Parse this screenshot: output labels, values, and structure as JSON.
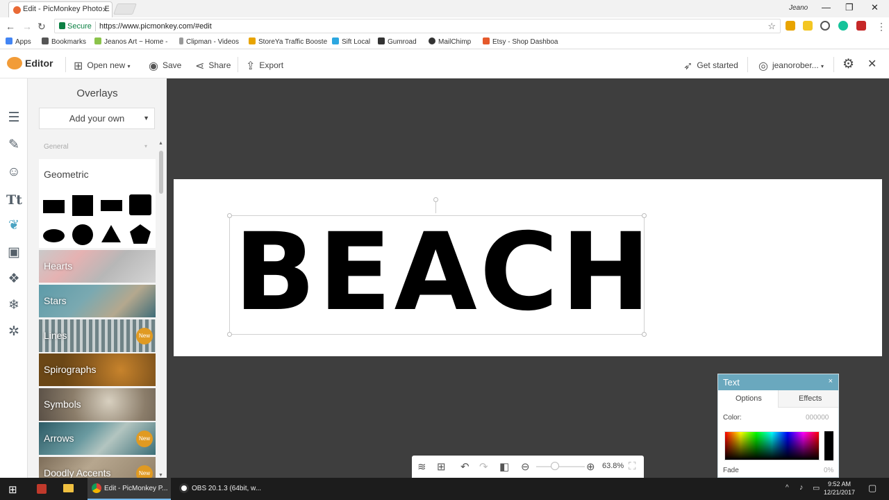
{
  "browser": {
    "tab_title": "Edit - PicMonkey Photo E",
    "tab_close": "×",
    "profile_name": "Jeano",
    "minimize": "—",
    "maximize": "❐",
    "close": "✕",
    "secure_label": "Secure",
    "url": "https://www.picmonkey.com/#edit"
  },
  "bookmarks": [
    {
      "label": "Apps",
      "color": "#4285f4"
    },
    {
      "label": "Bookmarks",
      "color": "#555555"
    },
    {
      "label": "Jeanos Art ~ Home -",
      "color": "#8bc34a"
    },
    {
      "label": "Clipman - Videos",
      "color": "#999999"
    },
    {
      "label": "StoreYa Traffic Booste",
      "color": "#e8a400"
    },
    {
      "label": "Sift Local",
      "color": "#2ca7e0"
    },
    {
      "label": "Gumroad",
      "color": "#333333"
    },
    {
      "label": "MailChimp",
      "color": "#333333"
    },
    {
      "label": "Etsy - Shop Dashboa",
      "color": "#e5592b"
    }
  ],
  "toolbar": {
    "logo": "Editor",
    "open_new": "Open new",
    "save": "Save",
    "share": "Share",
    "export": "Export",
    "get_started": "Get started",
    "user": "jeanorober..."
  },
  "panel": {
    "title": "Overlays",
    "add_own": "Add your own",
    "section": "General",
    "geometric": "Geometric",
    "categories": [
      {
        "label": "Hearts",
        "bg": "linear-gradient(135deg,#c9c9c9,#e5b2b2 30%,#b7b7b7 60%,#d5d5d5)",
        "badge": ""
      },
      {
        "label": "Stars",
        "bg": "linear-gradient(135deg,#5d9ba9,#7aa9b1 40%,#b4a88e 70%,#3f6c78)",
        "badge": ""
      },
      {
        "label": "Lines",
        "bg": "repeating-linear-gradient(90deg,#6f8387 0 5px,#c9d0d1 5px 9px)",
        "badge": "New"
      },
      {
        "label": "Spirographs",
        "bg": "radial-gradient(circle at 70% 50%,#c7832c,#8a5a1e 40%,#6b4716 70%)",
        "badge": ""
      },
      {
        "label": "Symbols",
        "bg": "radial-gradient(circle at 60% 40%,#d8d0c0,#8b7d6a 50%,#5a5046)",
        "badge": ""
      },
      {
        "label": "Arrows",
        "bg": "linear-gradient(135deg,#2d5b66,#6a9aa0 40%,#b3c5c0 60%,#3b6f78)",
        "badge": "New"
      },
      {
        "label": "Doodly Accents",
        "bg": "linear-gradient(135deg,#7c6c58,#b7a78f 40%,#8e7d66)",
        "badge": "New"
      }
    ]
  },
  "canvas": {
    "text": "BEACH"
  },
  "zoom": {
    "percent": "63.8%"
  },
  "text_palette": {
    "title": "Text",
    "close": "×",
    "tab_options": "Options",
    "tab_effects": "Effects",
    "color_label": "Color:",
    "color_value": "000000",
    "fade_label": "Fade",
    "fade_value": "0%"
  },
  "taskbar": {
    "chrome_task": "Edit - PicMonkey P...",
    "obs_task": "OBS 20.1.3 (64bit, w...",
    "time": "9:52 AM",
    "date": "12/21/2017"
  }
}
